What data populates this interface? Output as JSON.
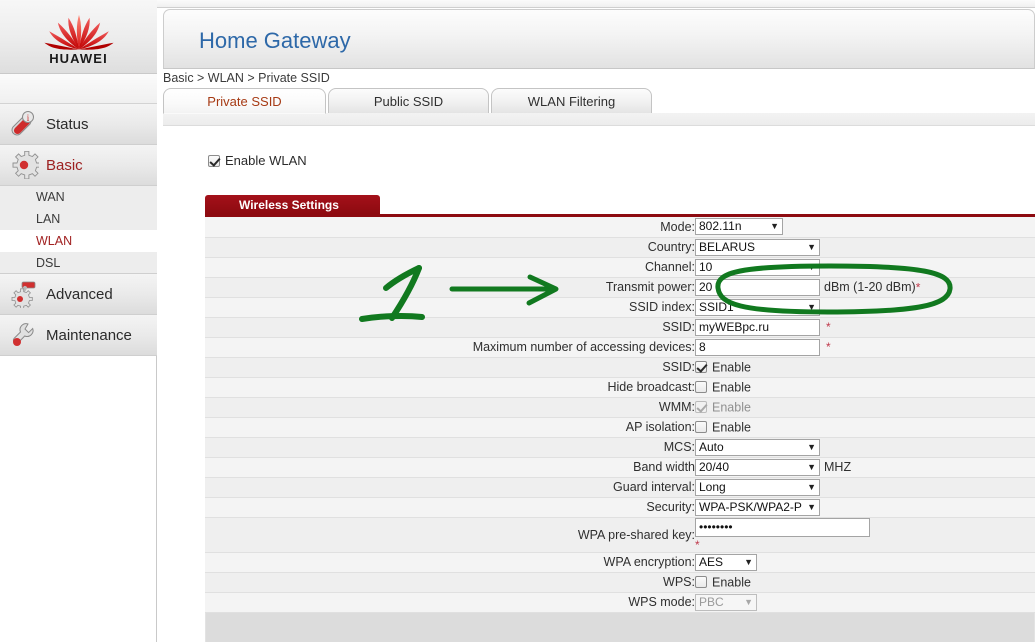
{
  "brand": {
    "name": "HUAWEI",
    "logo_icon": "huawei-flower-logo"
  },
  "header": {
    "title": "Home Gateway"
  },
  "breadcrumb": {
    "text": "Basic > WLAN > Private SSID"
  },
  "sidebar": {
    "items": [
      {
        "label": "Status",
        "icon": "status-icon",
        "active": false
      },
      {
        "label": "Basic",
        "icon": "gear-icon",
        "active": true
      },
      {
        "label": "Advanced",
        "icon": "advanced-gear-icon",
        "active": false
      },
      {
        "label": "Maintenance",
        "icon": "wrench-icon",
        "active": false
      }
    ],
    "basic_children": [
      {
        "label": "WAN",
        "active": false
      },
      {
        "label": "LAN",
        "active": false
      },
      {
        "label": "WLAN",
        "active": true
      },
      {
        "label": "DSL",
        "active": false
      }
    ]
  },
  "tabs": [
    {
      "label": "Private SSID",
      "active": true
    },
    {
      "label": "Public SSID",
      "active": false
    },
    {
      "label": "WLAN Filtering",
      "active": false
    }
  ],
  "enable_wlan": {
    "label": "Enable WLAN",
    "checked": true
  },
  "panel": {
    "title": "Wireless Settings",
    "rows": [
      {
        "label": "Mode:",
        "type": "select",
        "value": "802.11n",
        "width": "w88"
      },
      {
        "label": "Country:",
        "type": "select",
        "value": "BELARUS",
        "width": "w125"
      },
      {
        "label": "Channel:",
        "type": "select",
        "value": "10",
        "width": "w125"
      },
      {
        "label": "Transmit power:",
        "type": "text",
        "value": "20",
        "unit": "dBm (1-20 dBm)",
        "required_inline": "*"
      },
      {
        "label": "SSID index:",
        "type": "select",
        "value": "SSID1",
        "width": "w125"
      },
      {
        "label": "SSID:",
        "type": "text",
        "value": "myWEBpc.ru",
        "required_inline": "*"
      },
      {
        "label": "Maximum number of accessing devices:",
        "type": "text",
        "value": "8",
        "required_inline": "*"
      },
      {
        "label": "SSID:",
        "type": "checkbox",
        "value": "Enable",
        "checked": true,
        "disabled": false
      },
      {
        "label": "Hide broadcast:",
        "type": "checkbox",
        "value": "Enable",
        "checked": false,
        "disabled": false
      },
      {
        "label": "WMM:",
        "type": "checkbox",
        "value": "Enable",
        "checked": true,
        "disabled": true
      },
      {
        "label": "AP isolation:",
        "type": "checkbox",
        "value": "Enable",
        "checked": false,
        "disabled": false
      },
      {
        "label": "MCS:",
        "type": "select",
        "value": "Auto",
        "width": "w125"
      },
      {
        "label": "Band width",
        "type": "select",
        "value": "20/40",
        "width": "w125",
        "unit": "MHZ"
      },
      {
        "label": "Guard interval:",
        "type": "select",
        "value": "Long",
        "width": "w125"
      },
      {
        "label": "Security:",
        "type": "select",
        "value": "WPA-PSK/WPA2-P",
        "width": "w125"
      },
      {
        "label": "WPA pre-shared key:",
        "type": "password",
        "value": "••••••••",
        "required_below": "*"
      },
      {
        "label": "WPA encryption:",
        "type": "select",
        "value": "AES",
        "width": "w62"
      },
      {
        "label": "WPS:",
        "type": "checkbox",
        "value": "Enable",
        "checked": false,
        "disabled": false
      },
      {
        "label": "WPS mode:",
        "type": "select",
        "value": "PBC",
        "width": "w62",
        "disabled": true
      }
    ]
  },
  "annotations": {
    "color": "#11791f",
    "marks": [
      {
        "kind": "handwritten-number",
        "text": "1"
      },
      {
        "kind": "arrow",
        "points_to": "Transmit power:"
      },
      {
        "kind": "ellipse",
        "encircles": "transmit-power-field"
      }
    ]
  },
  "colors": {
    "brand_red": "#9e0b12",
    "title_blue": "#2d68a8",
    "active_tab_text": "#a63a14",
    "annotation_green": "#11791f",
    "required_star": "#c0394b"
  }
}
